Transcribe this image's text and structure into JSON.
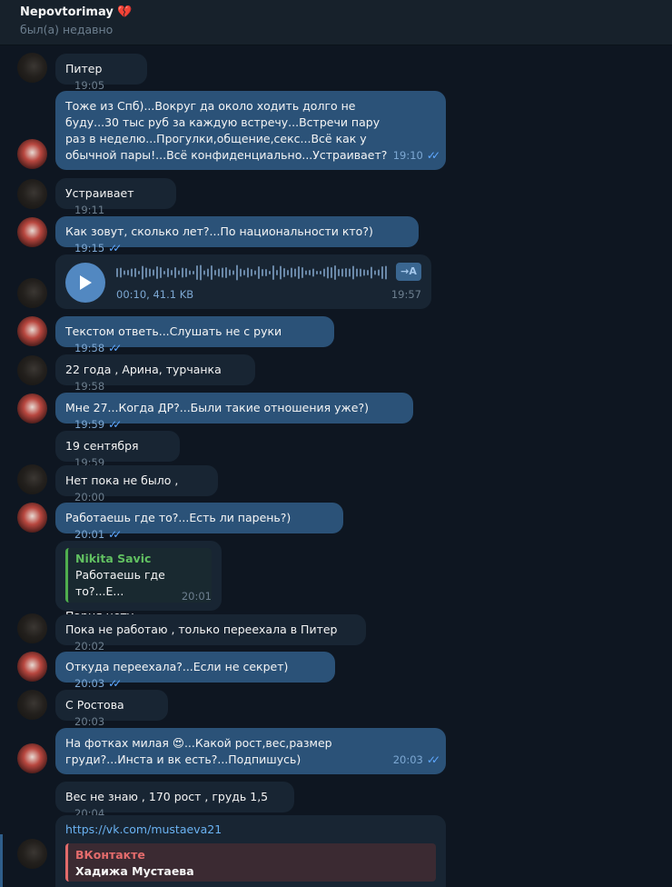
{
  "header": {
    "name": "Nepovtorimay",
    "emoji": "💔",
    "status": "был(а) недавно"
  },
  "messages": [
    {
      "dir": "in",
      "text": "Питер",
      "time": "19:05"
    },
    {
      "dir": "out",
      "text": "Тоже из Спб)...Вокруг да около ходить долго не буду...30 тыс руб за каждую встречу...Встречи пару раз в неделю...Прогулки,общение,секс...Всё как у обычной пары!...Всё конфиденциально...Устраивает?",
      "time": "19:10"
    },
    {
      "dir": "in",
      "text": "Устраивает",
      "time": "19:11"
    },
    {
      "dir": "out",
      "text": "Как зовут, сколько лет?...По национальности кто?)",
      "time": "19:15"
    },
    {
      "dir": "in",
      "type": "voice",
      "duration": "00:10, 41.1 KB",
      "translate": "→A",
      "time": "19:57"
    },
    {
      "dir": "out",
      "text": "Текстом ответь...Слушать не с руки",
      "time": "19:58"
    },
    {
      "dir": "in",
      "text": "22 года , Арина, турчанка",
      "time": "19:58"
    },
    {
      "dir": "out",
      "text": "Мне 27...Когда ДР?...Были такие отношения уже?)",
      "time": "19:59"
    },
    {
      "dir": "in",
      "text": "19 сентября",
      "time": "19:59"
    },
    {
      "dir": "in",
      "text": "Нет пока не было ,",
      "time": "20:00"
    },
    {
      "dir": "out",
      "text": "Работаешь где то?...Есть ли парень?)",
      "time": "20:01"
    },
    {
      "dir": "in",
      "reply_name": "Nikita Savic",
      "reply_text": "Работаешь где то?...Е...",
      "text": "Парня нету",
      "time": "20:01"
    },
    {
      "dir": "in",
      "text": "Пока не работаю , только переехала в Питер",
      "time": "20:02"
    },
    {
      "dir": "out",
      "text": "Откуда переехала?...Если не секрет)",
      "time": "20:03"
    },
    {
      "dir": "in",
      "text": "С Ростова",
      "time": "20:03"
    },
    {
      "dir": "out",
      "text": "На фотках милая 😍...Какой рост,вес,размер груди?...Инста и вк есть?...Подпишусь)",
      "time": "20:03"
    },
    {
      "dir": "in",
      "text": "Вес не знаю , 170 рост , грудь 1,5",
      "time": "20:04"
    },
    {
      "dir": "in",
      "link": "https://vk.com/mustaeva21",
      "preview_site": "ВКонтакте",
      "preview_title": "Хадижа Мустаева"
    }
  ]
}
